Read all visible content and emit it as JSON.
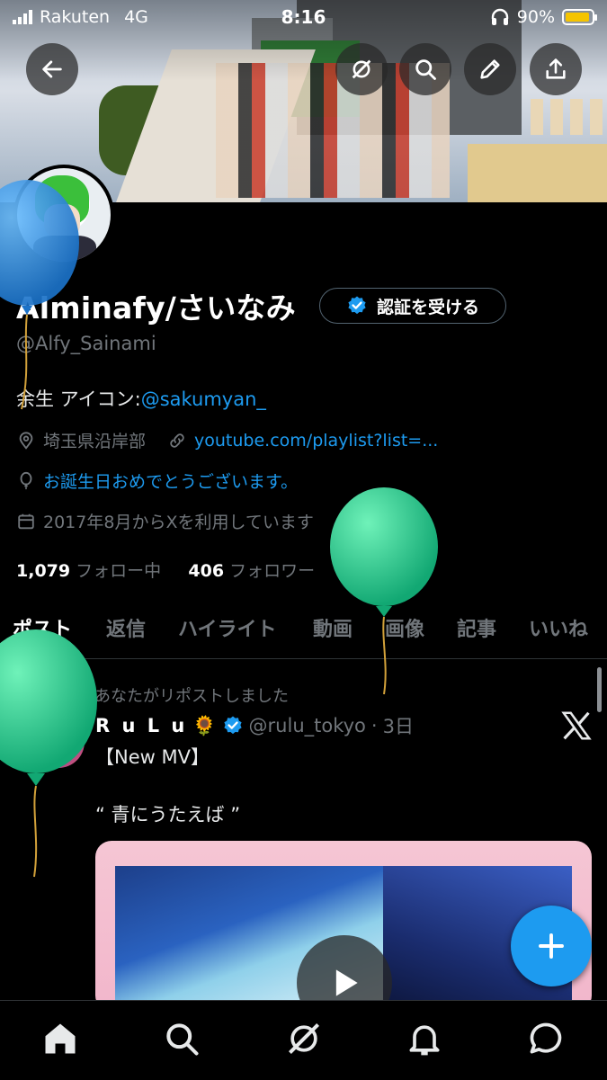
{
  "status_bar": {
    "carrier": "Rakuten",
    "network": "4G",
    "time": "8:16",
    "battery": "90%"
  },
  "header": {
    "back_icon": "arrow-left-icon",
    "grok_icon": "grok-icon",
    "search_icon": "search-icon",
    "edit_icon": "pencil-icon",
    "share_icon": "share-icon"
  },
  "profile": {
    "display_name": "Alminafy/さいなみ",
    "verify_button": "認証を受ける",
    "handle": "@Alfy_Sainami",
    "bio_prefix": "余生 アイコン:",
    "bio_link": "@sakumyan_",
    "location": "埼玉県沿岸部",
    "website": "youtube.com/playlist?list=...",
    "birthday": "お誕生日おめでとうございます。",
    "joined": "2017年8月からXを利用しています",
    "following_count": "1,079",
    "following_label": "フォロー中",
    "followers_count": "406",
    "followers_label": "フォロワー"
  },
  "tabs": [
    {
      "label": "ポスト",
      "active": true
    },
    {
      "label": "返信",
      "active": false
    },
    {
      "label": "ハイライト",
      "active": false
    },
    {
      "label": "動画",
      "active": false
    },
    {
      "label": "画像",
      "active": false
    },
    {
      "label": "記事",
      "active": false
    },
    {
      "label": "いいね",
      "active": false
    }
  ],
  "post": {
    "repost_label": "あなたがリポストしました",
    "author_name": "R u L u",
    "author_emoji": "🌻",
    "author_handle": "@rulu_tokyo",
    "separator": "·",
    "time": "3日",
    "line1": "【New MV】",
    "line2": "“ 青にうたえば ”"
  },
  "bottom_nav": [
    "home-icon",
    "search-icon",
    "grok-icon",
    "bell-icon",
    "messages-icon"
  ],
  "colors": {
    "accent": "#1d9bf0",
    "muted": "#71767b",
    "balloon_blue": "#2f8fe0",
    "balloon_green": "#1fc98e"
  }
}
